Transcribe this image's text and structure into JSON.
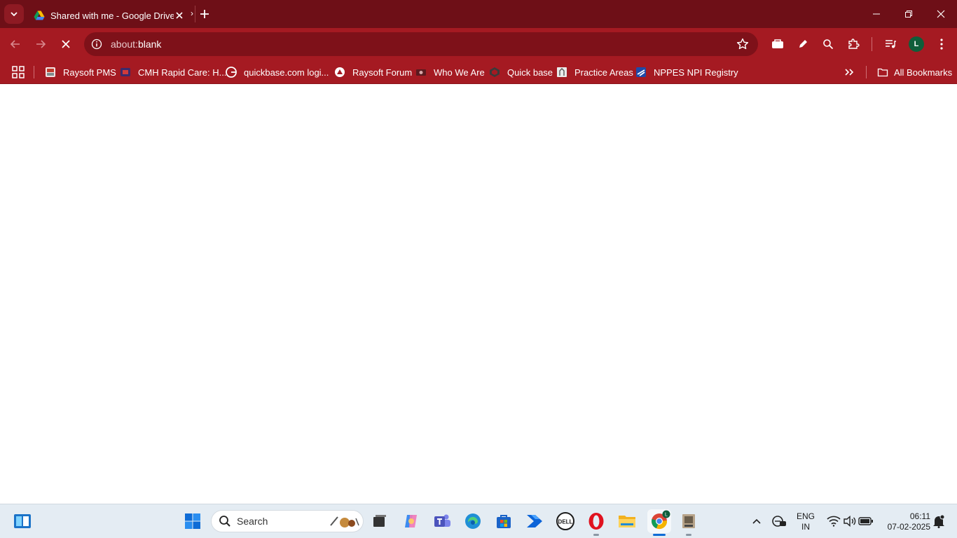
{
  "browser": {
    "tab": {
      "title": "Shared with me - Google Drive",
      "favicon": "google-drive-icon"
    },
    "omnibox": {
      "url_prefix": "about:",
      "url_main": "blank"
    },
    "profile_initial": "L",
    "colors": {
      "frame": "#6e0f17",
      "toolbar": "#a51a22",
      "omnibox": "#7e1119"
    }
  },
  "bookmarks": {
    "items": [
      {
        "label": "Raysoft PMS"
      },
      {
        "label": "CMH Rapid Care: H..."
      },
      {
        "label": "quickbase.com logi..."
      },
      {
        "label": "Raysoft Forum"
      },
      {
        "label": "Who We Are"
      },
      {
        "label": "Quick base"
      },
      {
        "label": "Practice Areas"
      },
      {
        "label": "NPPES NPI Registry"
      }
    ],
    "all_label": "All Bookmarks"
  },
  "taskbar": {
    "search_label": "Search",
    "apps": [
      "start-icon",
      "copilot-icon",
      "teams-icon",
      "edge-icon",
      "store-icon",
      "power-automate-icon",
      "dell-icon",
      "opera-icon",
      "file-explorer-icon",
      "chrome-icon",
      "app-icon"
    ],
    "tray": {
      "lang_top": "ENG",
      "lang_bottom": "IN",
      "time": "06:11",
      "date": "07-02-2025"
    }
  }
}
